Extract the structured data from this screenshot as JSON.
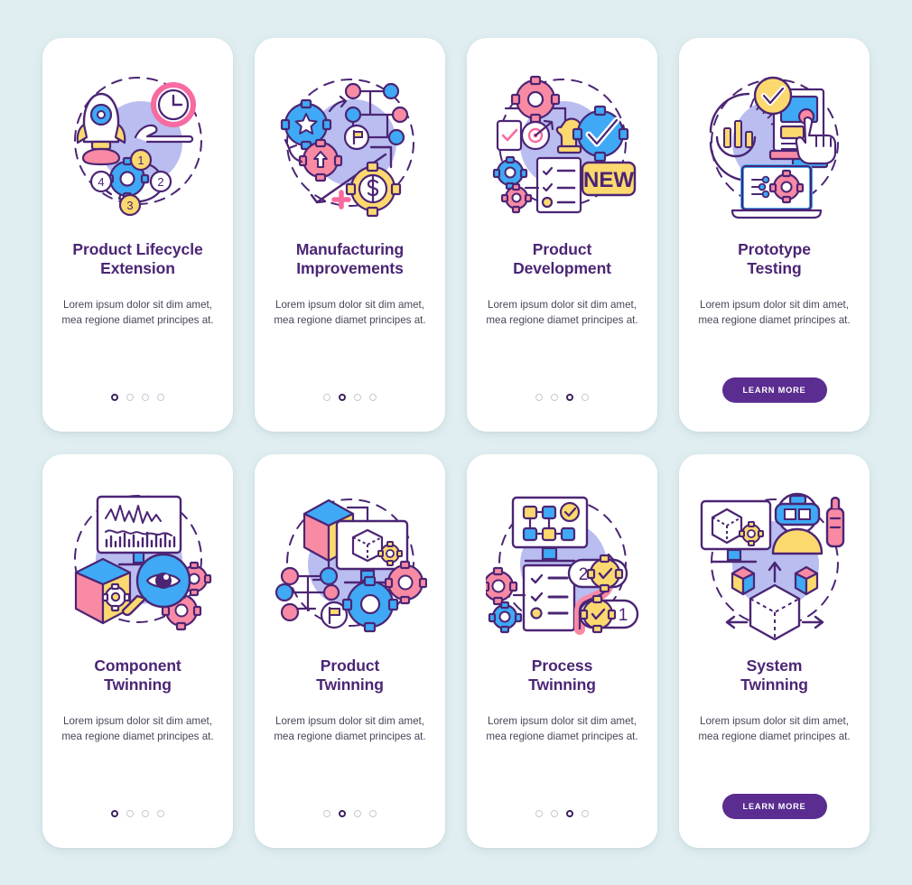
{
  "page": {
    "background_color": "#e0eef1",
    "card_background": "#ffffff",
    "title_color": "#4b2574",
    "body_color": "#4a4458",
    "accent_color": "#5b2d90",
    "dot_active_color": "#3d2160",
    "dot_inactive_color": "#c9c7d2"
  },
  "cards": [
    {
      "id": "product-lifecycle-extension",
      "title": "Product Lifecycle Extension",
      "title_line1": "Product Lifecycle",
      "title_line2": "Extension",
      "description": "Lorem ipsum dolor sit dim amet, mea regione diamet principes at.",
      "illustration": "rocket-gear-clock-hand-cycle-illustration",
      "footer_type": "dots",
      "dots": {
        "count": 4,
        "active_index": 0
      }
    },
    {
      "id": "manufacturing-improvements",
      "title": "Manufacturing Improvements",
      "title_line1": "Manufacturing",
      "title_line2": "Improvements",
      "description": "Lorem ipsum dolor sit dim amet, mea regione diamet principes at.",
      "illustration": "gears-star-arrow-dollar-growth-illustration",
      "footer_type": "dots",
      "dots": {
        "count": 4,
        "active_index": 1
      }
    },
    {
      "id": "product-development",
      "title": "Product Development",
      "title_line1": "Product",
      "title_line2": "Development",
      "description": "Lorem ipsum dolor sit dim amet, mea regione diamet principes at.",
      "illustration": "gears-checklist-target-new-badge-illustration",
      "badge_text": "NEW",
      "footer_type": "dots",
      "dots": {
        "count": 4,
        "active_index": 2
      }
    },
    {
      "id": "prototype-testing",
      "title": "Prototype Testing",
      "title_line1": "Prototype",
      "title_line2": "Testing",
      "description": "Lorem ipsum dolor sit dim amet, mea regione diamet principes at.",
      "illustration": "chart-checkmark-hand-laptop-gear-illustration",
      "footer_type": "button",
      "button_label": "LEARN MORE"
    },
    {
      "id": "component-twinning",
      "title": "Component Twinning",
      "title_line1": "Component",
      "title_line2": "Twinning",
      "description": "Lorem ipsum dolor sit dim amet, mea regione diamet principes at.",
      "illustration": "monitor-waveform-cube-magnifier-eye-gears-illustration",
      "footer_type": "dots",
      "dots": {
        "count": 4,
        "active_index": 0
      }
    },
    {
      "id": "product-twinning",
      "title": "Product Twinning",
      "title_line1": "Product",
      "title_line2": "Twinning",
      "description": "Lorem ipsum dolor sit dim amet, mea regione diamet principes at.",
      "illustration": "cube-monitor-network-gears-flag-illustration",
      "footer_type": "dots",
      "dots": {
        "count": 4,
        "active_index": 1
      }
    },
    {
      "id": "process-twinning",
      "title": "Process Twinning",
      "title_line1": "Process",
      "title_line2": "Twinning",
      "description": "Lorem ipsum dolor sit dim amet, mea regione diamet principes at.",
      "illustration": "flowchart-monitor-checklist-steps-gears-illustration",
      "step_labels": [
        "1",
        "2"
      ],
      "footer_type": "dots",
      "dots": {
        "count": 4,
        "active_index": 2
      }
    },
    {
      "id": "system-twinning",
      "title": "System Twinning",
      "title_line1": "System",
      "title_line2": "Twinning",
      "description": "Lorem ipsum dolor sit dim amet, mea regione diamet principes at.",
      "illustration": "monitor-cube-vr-person-cubes-illustration",
      "footer_type": "button",
      "button_label": "LEARN MORE"
    }
  ]
}
